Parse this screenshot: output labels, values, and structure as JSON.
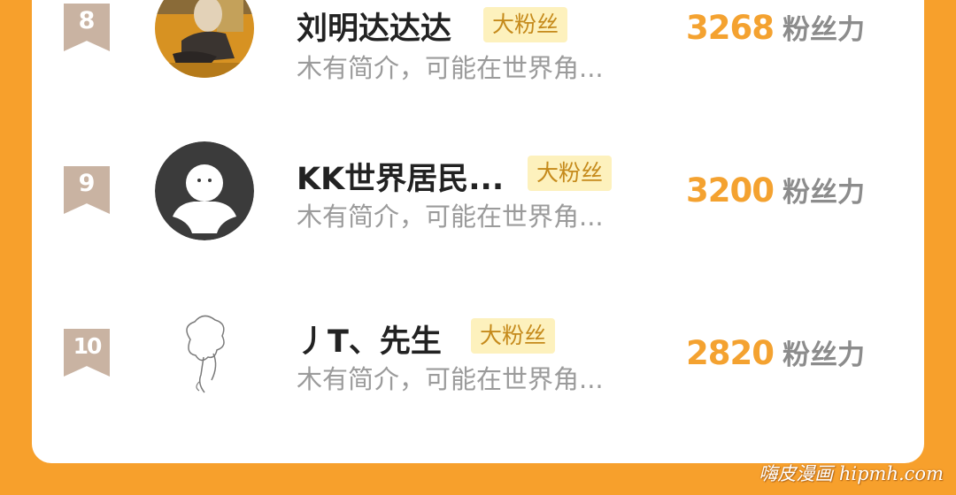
{
  "ranking": [
    {
      "rank": "8",
      "name": "刘明达达达",
      "badge": "大粉丝",
      "intro": "木有简介，可能在世界角...",
      "score": "3268",
      "score_unit": "粉丝力",
      "avatar": "photo-avatar"
    },
    {
      "rank": "9",
      "name": "KK世界居民...",
      "badge": "大粉丝",
      "intro": "木有简介，可能在世界角...",
      "score": "3200",
      "score_unit": "粉丝力",
      "avatar": "default-avatar-icon"
    },
    {
      "rank": "10",
      "name": "丿T、先生",
      "badge": "大粉丝",
      "intro": "木有简介，可能在世界角...",
      "score": "2820",
      "score_unit": "粉丝力",
      "avatar": "sketch-avatar"
    }
  ],
  "watermark": "嗨皮漫画 hipmh.com",
  "colors": {
    "background": "#f7a02c",
    "score": "#f4a230",
    "badge_bg": "#fdf1bd",
    "badge_text": "#c58a1b",
    "rank_ribbon": "#c9b3a2"
  }
}
